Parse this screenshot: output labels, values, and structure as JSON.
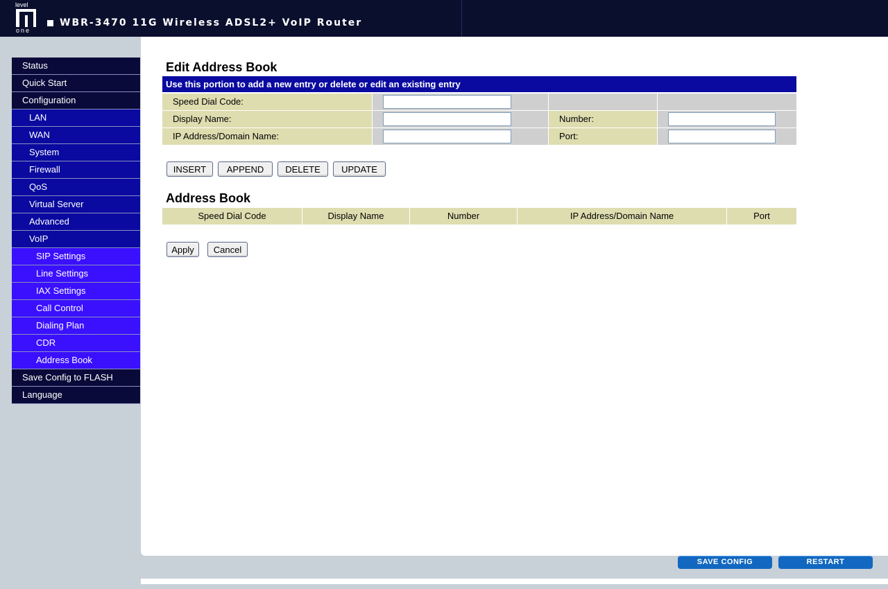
{
  "header": {
    "logo_top": "level",
    "logo_bottom": "one",
    "title": "WBR-3470 11G Wireless ADSL2+ VoIP Router"
  },
  "sidebar": {
    "items": [
      {
        "label": "Status",
        "level": 0
      },
      {
        "label": "Quick Start",
        "level": 0
      },
      {
        "label": "Configuration",
        "level": 0
      },
      {
        "label": "LAN",
        "level": 1
      },
      {
        "label": "WAN",
        "level": 1
      },
      {
        "label": "System",
        "level": 1
      },
      {
        "label": "Firewall",
        "level": 1
      },
      {
        "label": "QoS",
        "level": 1
      },
      {
        "label": "Virtual Server",
        "level": 1
      },
      {
        "label": "Advanced",
        "level": 1
      },
      {
        "label": "VoIP",
        "level": 1
      },
      {
        "label": "SIP Settings",
        "level": 2
      },
      {
        "label": "Line Settings",
        "level": 2
      },
      {
        "label": "IAX Settings",
        "level": 2
      },
      {
        "label": "Call Control",
        "level": 2
      },
      {
        "label": "Dialing Plan",
        "level": 2
      },
      {
        "label": "CDR",
        "level": 2
      },
      {
        "label": "Address Book",
        "level": 2
      },
      {
        "label": "Save Config to FLASH",
        "level": 0
      },
      {
        "label": "Language",
        "level": 0
      }
    ]
  },
  "edit": {
    "title": "Edit Address Book",
    "banner": "Use this portion to add a new entry or delete or edit an existing entry",
    "speed_dial_label": "Speed Dial Code:",
    "speed_dial_value": "",
    "display_name_label": "Display Name:",
    "display_name_value": "",
    "number_label": "Number:",
    "number_value": "",
    "ip_label": "IP Address/Domain Name:",
    "ip_value": "",
    "port_label": "Port:",
    "port_value": "",
    "buttons": {
      "insert": "INSERT",
      "append": "APPEND",
      "delete": "DELETE",
      "update": "UPDATE"
    }
  },
  "book": {
    "title": "Address Book",
    "columns": [
      "Speed Dial Code",
      "Display Name",
      "Number",
      "IP Address/Domain Name",
      "Port"
    ],
    "rows": []
  },
  "actions": {
    "apply": "Apply",
    "cancel": "Cancel"
  },
  "footer": {
    "save_config": "SAVE CONFIG",
    "restart": "RESTART"
  },
  "colors": {
    "header_bg": "#0b0f2e",
    "nav_top": "#0a0a3a",
    "nav_sub": "#0a0aa0",
    "nav_sub2": "#3a10ff",
    "label_bg": "#deddb0",
    "footer_button": "#1268c0"
  }
}
